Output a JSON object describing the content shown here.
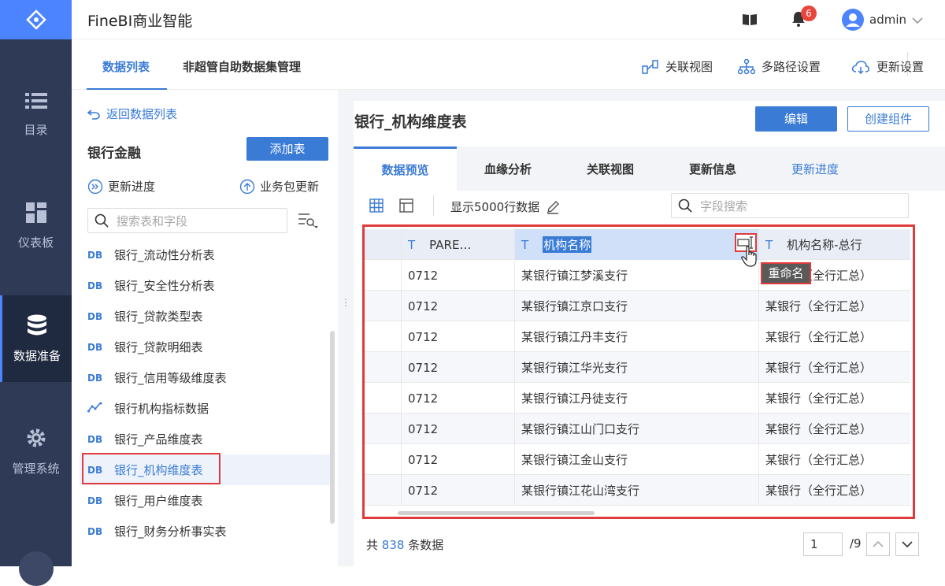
{
  "app": {
    "title": "FineBI商业智能"
  },
  "nav": {
    "items": [
      {
        "label": "目录",
        "icon": "list-icon"
      },
      {
        "label": "仪表板",
        "icon": "dashboard-icon"
      },
      {
        "label": "数据准备",
        "icon": "database-icon"
      },
      {
        "label": "管理系统",
        "icon": "gear-icon"
      }
    ]
  },
  "header": {
    "badge": "6",
    "user": "admin"
  },
  "subtabs": [
    "数据列表",
    "非超管自助数据集管理"
  ],
  "tools": {
    "relation_view": "关联视图",
    "multipath": "多路径设置",
    "update_settings": "更新设置"
  },
  "left": {
    "back": "返回数据列表",
    "package": "银行金融",
    "add_table": "添加表",
    "update_progress": "更新进度",
    "package_update": "业务包更新",
    "search_placeholder": "搜索表和字段",
    "db_tag": "DB",
    "tables": [
      "银行_流动性分析表",
      "银行_安全性分析表",
      "银行_贷款类型表",
      "银行_贷款明细表",
      "银行_信用等级维度表",
      "银行机构指标数据",
      "银行_产品维度表",
      "银行_机构维度表",
      "银行_用户维度表",
      "银行_财务分析事实表"
    ]
  },
  "detail": {
    "title": "银行_机构维度表",
    "edit": "编辑",
    "create_component": "创建组件",
    "tabs": [
      "数据预览",
      "血缘分析",
      "关联视图",
      "更新信息",
      "更新进度"
    ],
    "row_limit": "显示5000行数据",
    "field_search": "字段搜索",
    "type_tag": "T",
    "columns": [
      "PARE…",
      "机构名称",
      "机构名称-总行"
    ],
    "rows": [
      [
        "0712",
        "某银行镇江梦溪支行",
        "某银行（全行汇总）"
      ],
      [
        "0712",
        "某银行镇江京口支行",
        "某银行（全行汇总）"
      ],
      [
        "0712",
        "某银行镇江丹丰支行",
        "某银行（全行汇总）"
      ],
      [
        "0712",
        "某银行镇江华光支行",
        "某银行（全行汇总）"
      ],
      [
        "0712",
        "某银行镇江丹徒支行",
        "某银行（全行汇总）"
      ],
      [
        "0712",
        "某银行镇江山门口支行",
        "某银行（全行汇总）"
      ],
      [
        "0712",
        "某银行镇江金山支行",
        "某银行（全行汇总）"
      ],
      [
        "0712",
        "某银行镇江花山湾支行",
        "某银行（全行汇总）"
      ]
    ],
    "rename_tip": "重命名",
    "total_prefix": "共",
    "total_count": "838",
    "total_suffix": "条数据",
    "page": "1",
    "page_total": "/9"
  }
}
